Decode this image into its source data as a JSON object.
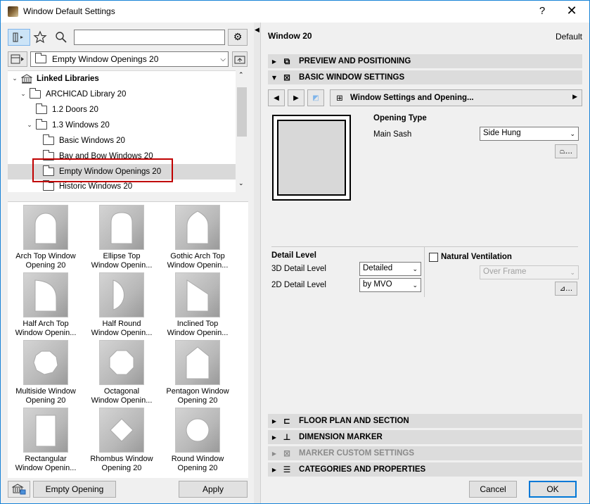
{
  "window": {
    "title": "Window Default Settings",
    "help": "?",
    "close": "✕"
  },
  "left": {
    "search_value": "",
    "path": "Empty Window Openings 20",
    "tree": [
      {
        "label": "Linked Libraries",
        "bold": true
      },
      {
        "label": "ARCHICAD Library 20"
      },
      {
        "label": "1.2 Doors 20"
      },
      {
        "label": "1.3 Windows 20"
      },
      {
        "label": "Basic Windows 20"
      },
      {
        "label": "Bay and Bow Windows 20"
      },
      {
        "label": "Empty Window Openings 20",
        "selected": true
      },
      {
        "label": "Historic Windows 20"
      }
    ],
    "gallery": [
      {
        "label": "Arch Top Window\nOpening 20",
        "shape": "arch"
      },
      {
        "label": "Ellipse Top\nWindow Openin...",
        "shape": "ellipse"
      },
      {
        "label": "Gothic Arch Top\nWindow Openin...",
        "shape": "gothic"
      },
      {
        "label": "Half Arch Top\nWindow Openin...",
        "shape": "halfarch"
      },
      {
        "label": "Half Round\nWindow Openin...",
        "shape": "halfround"
      },
      {
        "label": "Inclined Top\nWindow Openin...",
        "shape": "inclined"
      },
      {
        "label": "Multiside Window\nOpening 20",
        "shape": "multiside"
      },
      {
        "label": "Octagonal\nWindow Openin...",
        "shape": "octagon"
      },
      {
        "label": "Pentagon Window\nOpening 20",
        "shape": "pentagon"
      },
      {
        "label": "Rectangular\nWindow Openin...",
        "shape": "rect"
      },
      {
        "label": "Rhombus Window\nOpening 20",
        "shape": "rhombus"
      },
      {
        "label": "Round Window\nOpening 20",
        "shape": "round"
      }
    ],
    "selected_object": "Empty Opening",
    "apply": "Apply"
  },
  "right": {
    "title": "Window 20",
    "default": "Default",
    "sections_top": [
      {
        "label": "PREVIEW AND POSITIONING",
        "expanded": false
      },
      {
        "label": "BASIC WINDOW SETTINGS",
        "expanded": true
      }
    ],
    "panel_select": "Window Settings and Opening...",
    "opening_type": "Opening Type",
    "main_sash_label": "Main Sash",
    "main_sash_value": "Side Hung",
    "detail_level": "Detail Level",
    "detail_3d_label": "3D Detail Level",
    "detail_3d_value": "Detailed",
    "detail_2d_label": "2D Detail Level",
    "detail_2d_value": "by MVO",
    "natural_ventilation": "Natural Ventilation",
    "over_frame": "Over Frame",
    "sections_bottom": [
      {
        "label": "FLOOR PLAN AND SECTION",
        "disabled": false
      },
      {
        "label": "DIMENSION MARKER",
        "disabled": false
      },
      {
        "label": "MARKER CUSTOM SETTINGS",
        "disabled": true
      },
      {
        "label": "CATEGORIES AND PROPERTIES",
        "disabled": false
      }
    ],
    "cancel": "Cancel",
    "ok": "OK"
  }
}
